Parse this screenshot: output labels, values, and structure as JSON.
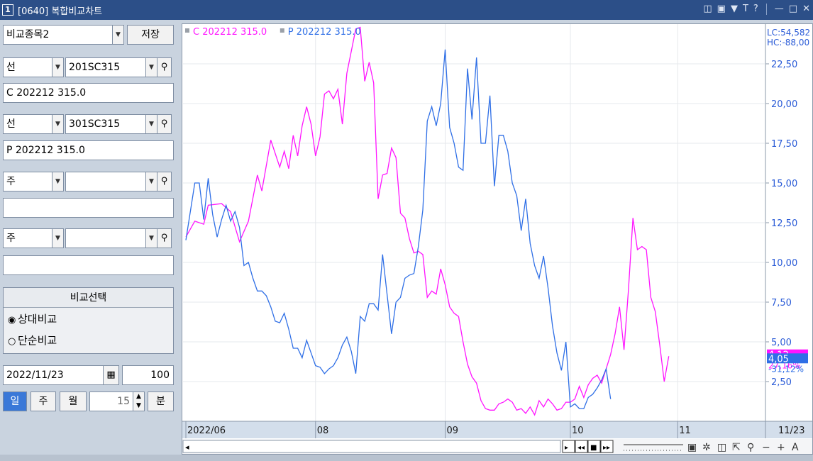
{
  "window": {
    "number": "1",
    "title": "[0640] 복합비교차트"
  },
  "left_panel": {
    "compare_set": "비교종목2",
    "save_label": "저장",
    "rows": [
      {
        "type": "선",
        "code": "201SC315",
        "name": "C 202212 315.0"
      },
      {
        "type": "선",
        "code": "301SC315",
        "name": "P 202212 315.0"
      },
      {
        "type": "주",
        "code": "",
        "name": ""
      },
      {
        "type": "주",
        "code": "",
        "name": ""
      }
    ],
    "compare_group": {
      "title": "비교선택",
      "options": [
        "상대비교",
        "단순비교"
      ],
      "selected_index": 0
    },
    "date": "2022/11/23",
    "count": "100",
    "tabs": [
      "일",
      "주",
      "월"
    ],
    "active_tab_index": 0,
    "minute_value": "15",
    "minute_label": "분"
  },
  "colors": {
    "call": "#ff14ff",
    "put": "#2f6fe6",
    "axis_text": "#2a5bd7"
  },
  "chart_data": {
    "type": "line",
    "legend": [
      {
        "label": "C 202212 315.0",
        "color": "#ff14ff"
      },
      {
        "label": "P 202212 315.0",
        "color": "#2f6fe6"
      }
    ],
    "x_labels": [
      "2022/06",
      "08",
      "09",
      "10",
      "11",
      "11/23"
    ],
    "x_label_indices": [
      0,
      29,
      58,
      86,
      110,
      137
    ],
    "y_ticks": [
      2.5,
      5.0,
      7.5,
      10.0,
      12.5,
      15.0,
      17.5,
      20.0,
      22.5
    ],
    "y_tick_labels": [
      "2,50",
      "5,00",
      "7,50",
      "10,00",
      "12,50",
      "15,00",
      "17,50",
      "20,00",
      "22,50"
    ],
    "ylim": [
      0,
      25
    ],
    "n_points": 130,
    "lc_label": "LC:54,582",
    "hc_label": "HC:-88,00",
    "call_last": {
      "value": 4.12,
      "label": "4,12",
      "pct": "27,16%"
    },
    "put_last": {
      "value": 4.05,
      "label": "4,05",
      "pct": "-31,12%"
    },
    "series": [
      {
        "name": "C 202212 315.0",
        "color": "#ff14ff",
        "points": [
          [
            0,
            11.6
          ],
          [
            2,
            12.6
          ],
          [
            4,
            12.4
          ],
          [
            5,
            13.6
          ],
          [
            8,
            13.7
          ],
          [
            10,
            13.2
          ],
          [
            12,
            11.3
          ],
          [
            14,
            12.6
          ],
          [
            16,
            15.5
          ],
          [
            17,
            14.5
          ],
          [
            19,
            17.7
          ],
          [
            21,
            16.0
          ],
          [
            22,
            17.0
          ],
          [
            23,
            15.9
          ],
          [
            24,
            18.0
          ],
          [
            25,
            16.7
          ],
          [
            26,
            18.6
          ],
          [
            27,
            19.8
          ],
          [
            28,
            18.7
          ],
          [
            29,
            16.7
          ],
          [
            30,
            17.9
          ],
          [
            31,
            20.6
          ],
          [
            32,
            20.8
          ],
          [
            33,
            20.3
          ],
          [
            34,
            20.9
          ],
          [
            35,
            18.7
          ],
          [
            36,
            21.9
          ],
          [
            37,
            23.3
          ],
          [
            38,
            24.7
          ],
          [
            39,
            24.8
          ],
          [
            40,
            21.4
          ],
          [
            41,
            22.6
          ],
          [
            42,
            21.3
          ],
          [
            43,
            14.0
          ],
          [
            44,
            15.5
          ],
          [
            45,
            15.6
          ],
          [
            46,
            17.2
          ],
          [
            47,
            16.6
          ],
          [
            48,
            13.1
          ],
          [
            49,
            12.8
          ],
          [
            50,
            11.5
          ],
          [
            51,
            10.6
          ],
          [
            52,
            10.7
          ],
          [
            53,
            10.5
          ],
          [
            54,
            7.8
          ],
          [
            55,
            8.2
          ],
          [
            56,
            8.0
          ],
          [
            57,
            9.6
          ],
          [
            58,
            8.6
          ],
          [
            59,
            7.2
          ],
          [
            60,
            6.8
          ],
          [
            61,
            6.6
          ],
          [
            62,
            5.0
          ],
          [
            63,
            3.6
          ],
          [
            64,
            2.8
          ],
          [
            65,
            2.4
          ],
          [
            66,
            1.3
          ],
          [
            67,
            0.8
          ],
          [
            68,
            0.7
          ],
          [
            69,
            0.7
          ],
          [
            70,
            1.1
          ],
          [
            71,
            1.2
          ],
          [
            72,
            1.4
          ],
          [
            73,
            1.2
          ],
          [
            74,
            0.7
          ],
          [
            75,
            0.8
          ],
          [
            76,
            0.5
          ],
          [
            77,
            0.9
          ],
          [
            78,
            0.4
          ],
          [
            79,
            1.3
          ],
          [
            80,
            0.9
          ],
          [
            81,
            1.4
          ],
          [
            82,
            1.1
          ],
          [
            83,
            0.7
          ],
          [
            84,
            0.8
          ],
          [
            85,
            1.2
          ],
          [
            86,
            1.2
          ],
          [
            87,
            1.4
          ],
          [
            88,
            2.2
          ],
          [
            89,
            1.5
          ],
          [
            90,
            2.3
          ],
          [
            91,
            2.7
          ],
          [
            92,
            2.9
          ],
          [
            93,
            2.4
          ],
          [
            94,
            3.3
          ],
          [
            95,
            4.2
          ],
          [
            96,
            5.5
          ],
          [
            97,
            7.2
          ],
          [
            98,
            4.5
          ],
          [
            99,
            8.3
          ],
          [
            100,
            12.8
          ],
          [
            101,
            10.8
          ],
          [
            102,
            11.0
          ],
          [
            103,
            10.8
          ],
          [
            104,
            7.8
          ],
          [
            105,
            6.9
          ],
          [
            106,
            4.8
          ],
          [
            107,
            2.5
          ],
          [
            108,
            4.1
          ]
        ]
      },
      {
        "name": "P 202212 315.0",
        "color": "#2f6fe6",
        "points": [
          [
            0,
            11.4
          ],
          [
            2,
            15.0
          ],
          [
            3,
            15.0
          ],
          [
            4,
            12.7
          ],
          [
            5,
            15.3
          ],
          [
            6,
            13.0
          ],
          [
            7,
            11.6
          ],
          [
            8,
            12.7
          ],
          [
            9,
            13.6
          ],
          [
            10,
            12.6
          ],
          [
            11,
            13.2
          ],
          [
            12,
            12.2
          ],
          [
            13,
            9.8
          ],
          [
            14,
            10.0
          ],
          [
            15,
            9.0
          ],
          [
            16,
            8.2
          ],
          [
            17,
            8.2
          ],
          [
            18,
            7.9
          ],
          [
            19,
            7.2
          ],
          [
            20,
            6.3
          ],
          [
            21,
            6.2
          ],
          [
            22,
            6.8
          ],
          [
            23,
            5.8
          ],
          [
            24,
            4.6
          ],
          [
            25,
            4.6
          ],
          [
            26,
            4.0
          ],
          [
            27,
            5.1
          ],
          [
            28,
            4.3
          ],
          [
            29,
            3.5
          ],
          [
            30,
            3.4
          ],
          [
            31,
            3.0
          ],
          [
            32,
            3.3
          ],
          [
            33,
            3.5
          ],
          [
            34,
            4.0
          ],
          [
            35,
            4.8
          ],
          [
            36,
            5.3
          ],
          [
            37,
            4.4
          ],
          [
            38,
            3.0
          ],
          [
            39,
            6.6
          ],
          [
            40,
            6.3
          ],
          [
            41,
            7.4
          ],
          [
            42,
            7.4
          ],
          [
            43,
            7.0
          ],
          [
            44,
            10.5
          ],
          [
            45,
            8.0
          ],
          [
            46,
            5.5
          ],
          [
            47,
            7.5
          ],
          [
            48,
            7.8
          ],
          [
            49,
            9.0
          ],
          [
            50,
            9.2
          ],
          [
            51,
            9.3
          ],
          [
            52,
            11.0
          ],
          [
            53,
            13.3
          ],
          [
            54,
            18.9
          ],
          [
            55,
            19.8
          ],
          [
            56,
            18.6
          ],
          [
            57,
            20.0
          ],
          [
            58,
            23.4
          ],
          [
            59,
            18.5
          ],
          [
            60,
            17.5
          ],
          [
            61,
            16.0
          ],
          [
            62,
            15.8
          ],
          [
            63,
            22.2
          ],
          [
            64,
            19.0
          ],
          [
            65,
            22.9
          ],
          [
            66,
            17.5
          ],
          [
            67,
            17.5
          ],
          [
            68,
            20.5
          ],
          [
            69,
            14.8
          ],
          [
            70,
            18.0
          ],
          [
            71,
            18.0
          ],
          [
            72,
            17.0
          ],
          [
            73,
            15.0
          ],
          [
            74,
            14.2
          ],
          [
            75,
            12.0
          ],
          [
            76,
            14.0
          ],
          [
            77,
            11.2
          ],
          [
            78,
            9.8
          ],
          [
            79,
            9.0
          ],
          [
            80,
            10.4
          ],
          [
            81,
            8.4
          ],
          [
            82,
            6.0
          ],
          [
            83,
            4.3
          ],
          [
            84,
            3.2
          ],
          [
            85,
            5.0
          ],
          [
            86,
            0.9
          ],
          [
            87,
            1.1
          ],
          [
            88,
            0.8
          ],
          [
            89,
            0.8
          ],
          [
            90,
            1.5
          ],
          [
            91,
            1.7
          ],
          [
            92,
            2.1
          ],
          [
            93,
            2.6
          ],
          [
            94,
            3.3
          ],
          [
            95,
            1.4
          ]
        ]
      }
    ]
  }
}
